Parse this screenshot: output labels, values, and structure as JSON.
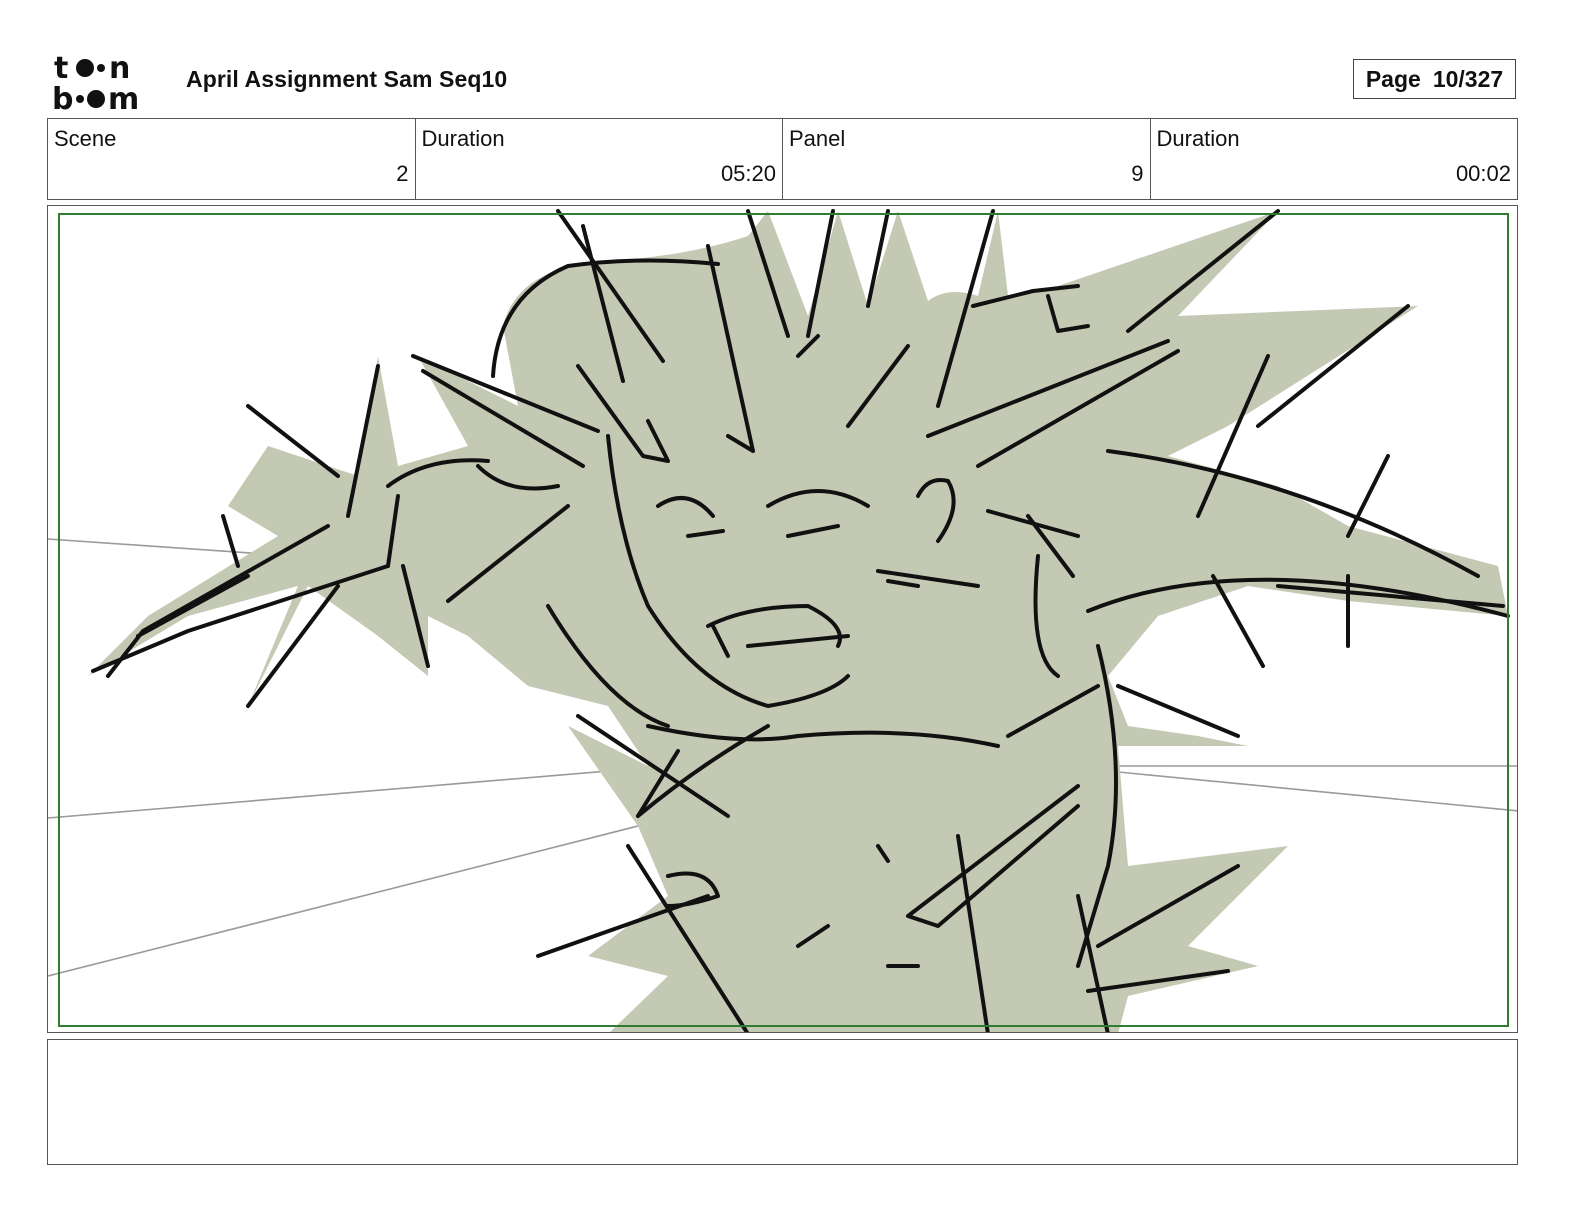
{
  "logo": {
    "brand_line1": "toon",
    "brand_line2": "boom",
    "icon": "toon-boom-logo"
  },
  "header": {
    "title": "April Assignment Sam Seq10",
    "page_label": "Page",
    "page_value": "10/327"
  },
  "info": {
    "scene_label": "Scene",
    "scene_value": "2",
    "scene_duration_label": "Duration",
    "scene_duration_value": "05:20",
    "panel_label": "Panel",
    "panel_value": "9",
    "panel_duration_label": "Duration",
    "panel_duration_value": "00:02"
  },
  "panel": {
    "safe_frame_color": "#2e7d32",
    "fill_color": "#c3c9b2",
    "ink_color": "#111111",
    "speed_line_color": "#9a9a9a"
  },
  "notes": {
    "text": ""
  }
}
